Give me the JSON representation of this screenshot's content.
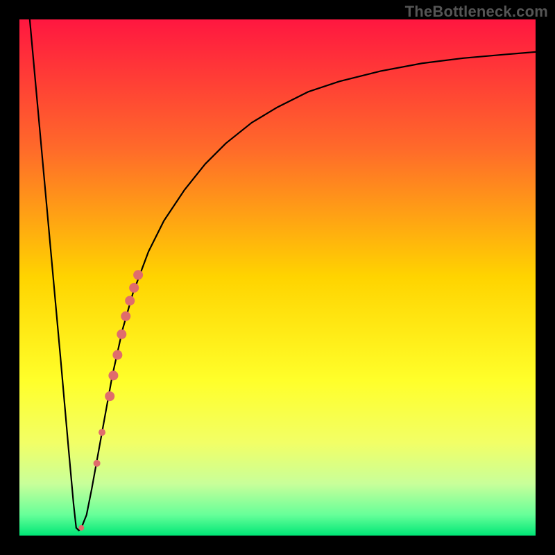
{
  "watermark": "TheBottleneck.com",
  "chart_data": {
    "type": "line",
    "title": "",
    "xlabel": "",
    "ylabel": "",
    "xlim": [
      0,
      100
    ],
    "ylim": [
      0,
      100
    ],
    "background_gradient": {
      "stops": [
        {
          "offset": 0.0,
          "color": "#ff1740"
        },
        {
          "offset": 0.25,
          "color": "#ff6a2a"
        },
        {
          "offset": 0.5,
          "color": "#ffd400"
        },
        {
          "offset": 0.7,
          "color": "#ffff2a"
        },
        {
          "offset": 0.82,
          "color": "#f2ff66"
        },
        {
          "offset": 0.9,
          "color": "#c8ff9a"
        },
        {
          "offset": 0.96,
          "color": "#66ff99"
        },
        {
          "offset": 1.0,
          "color": "#00e676"
        }
      ]
    },
    "series": [
      {
        "name": "bottleneck-curve",
        "color": "#000000",
        "x": [
          2,
          4,
          6,
          8,
          9.5,
          10.5,
          11,
          11.5,
          12,
          13,
          14,
          16,
          18,
          20,
          22,
          25,
          28,
          32,
          36,
          40,
          45,
          50,
          56,
          62,
          70,
          78,
          86,
          94,
          100
        ],
        "y": [
          100,
          78,
          56,
          34,
          17,
          6,
          1.5,
          1,
          1.5,
          4,
          9,
          20,
          31,
          40,
          47,
          55,
          61,
          67,
          72,
          76,
          80,
          83,
          86,
          88,
          90,
          91.5,
          92.5,
          93.2,
          93.7
        ]
      }
    ],
    "markers": {
      "name": "highlight-points",
      "color": "#e06c6c",
      "points": [
        {
          "x": 12.0,
          "y": 1.5,
          "r": 4
        },
        {
          "x": 15.0,
          "y": 14.0,
          "r": 5
        },
        {
          "x": 16.0,
          "y": 20.0,
          "r": 5
        },
        {
          "x": 17.5,
          "y": 27.0,
          "r": 7
        },
        {
          "x": 18.2,
          "y": 31.0,
          "r": 7
        },
        {
          "x": 19.0,
          "y": 35.0,
          "r": 7
        },
        {
          "x": 19.8,
          "y": 39.0,
          "r": 7
        },
        {
          "x": 20.6,
          "y": 42.5,
          "r": 7
        },
        {
          "x": 21.4,
          "y": 45.5,
          "r": 7
        },
        {
          "x": 22.2,
          "y": 48.0,
          "r": 7
        },
        {
          "x": 23.0,
          "y": 50.5,
          "r": 7
        }
      ]
    }
  }
}
